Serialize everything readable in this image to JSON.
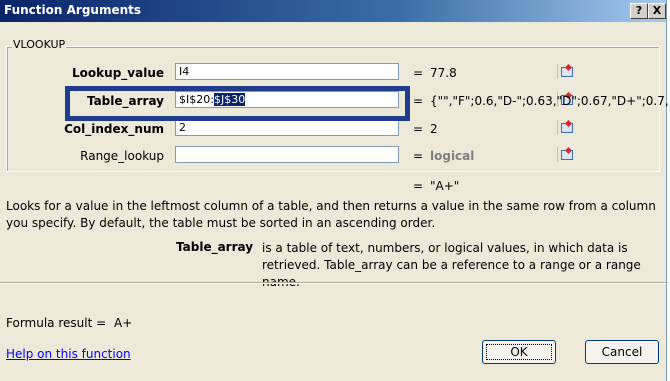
{
  "window": {
    "title": "Function Arguments",
    "help_glyph": "?",
    "close_glyph": "X"
  },
  "function_group": {
    "legend": "VLOOKUP"
  },
  "arguments": [
    {
      "label": "Lookup_value",
      "value": "I4",
      "result_eq": "=",
      "result": "77.8"
    },
    {
      "label": "Table_array",
      "value_plain": "$I$20:",
      "value_selected": "$J$30",
      "result_eq": "=",
      "result": "{\"\",\"F\";0.6,\"D-\";0.63,\"D\";0.67,\"D+\";0.7,"
    },
    {
      "label": "Col_index_num",
      "value": "2",
      "result_eq": "=",
      "result": "2"
    },
    {
      "label": "Range_lookup",
      "value": "",
      "result_eq": "=",
      "result": "logical"
    }
  ],
  "overall_result": {
    "eq": "=",
    "value": "\"A+\""
  },
  "description": "Looks for a value in the leftmost column of a table, and then returns a value in the same row from a column you specify. By default, the table must be sorted in an ascending order.",
  "argument_help": {
    "name": "Table_array",
    "text": "is a table of text, numbers, or logical values, in which data is retrieved. Table_array can be a reference to a range or a range name."
  },
  "formula_result": {
    "label": "Formula result =",
    "value": "A+"
  },
  "help_link": "Help on this function",
  "buttons": {
    "ok": "OK",
    "cancel": "Cancel"
  },
  "colors": {
    "highlight_box": "#1f3d8c",
    "title_bar": "#0a246a",
    "link": "#0000ff"
  }
}
